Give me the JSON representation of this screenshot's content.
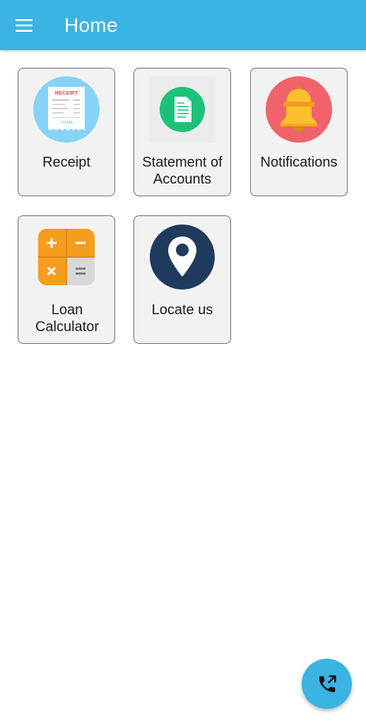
{
  "appbar": {
    "title": "Home",
    "menu_icon": "hamburger-menu-icon",
    "color": "#3bb3e3"
  },
  "tiles": [
    {
      "label": "Receipt",
      "icon": "receipt-icon",
      "icon_text_top": "RECEIPT",
      "icon_text_bottom": "TOTAL"
    },
    {
      "label": "Statement of Accounts",
      "icon": "document-icon"
    },
    {
      "label": "Notifications",
      "icon": "bell-icon"
    },
    {
      "label": "Loan Calculator",
      "icon": "calculator-icon"
    },
    {
      "label": "Locate us",
      "icon": "location-pin-icon"
    }
  ],
  "fab": {
    "icon": "phone-call-icon",
    "color": "#3bb3e3"
  }
}
